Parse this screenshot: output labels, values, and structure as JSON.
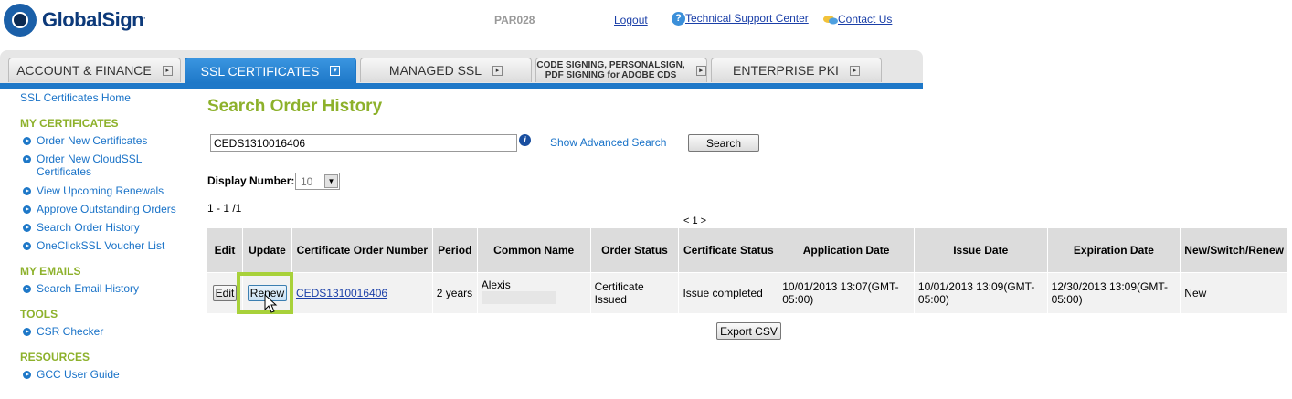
{
  "header": {
    "brand": "GlobalSign",
    "brand_mark": ".",
    "user_id": "PAR028",
    "logout": "Logout",
    "support": "Technical Support Center",
    "contact": "Contact Us"
  },
  "tabs": [
    {
      "label": "ACCOUNT & FINANCE",
      "active": false
    },
    {
      "label": "SSL CERTIFICATES",
      "active": true
    },
    {
      "label": "MANAGED SSL",
      "active": false
    },
    {
      "label_line1": "CODE SIGNING, PERSONALSIGN,",
      "label_line2": "PDF SIGNING for ADOBE CDS",
      "active": false
    },
    {
      "label": "ENTERPRISE PKI",
      "active": false
    }
  ],
  "sidebar": {
    "home": "SSL Certificates Home",
    "sections": [
      {
        "heading": "MY CERTIFICATES",
        "items": [
          "Order New Certificates",
          "Order New CloudSSL Certificates",
          "View Upcoming Renewals",
          "Approve Outstanding Orders",
          "Search Order History",
          "OneClickSSL Voucher List"
        ]
      },
      {
        "heading": "MY EMAILS",
        "items": [
          "Search Email History"
        ]
      },
      {
        "heading": "TOOLS",
        "items": [
          "CSR Checker"
        ]
      },
      {
        "heading": "RESOURCES",
        "items": [
          "GCC User Guide"
        ]
      }
    ]
  },
  "main": {
    "title": "Search Order History",
    "search_value": "CEDS1310016406",
    "advanced_search": "Show Advanced Search",
    "search_button": "Search",
    "display_number_label": "Display Number:",
    "display_number_value": "10",
    "result_count": "1 - 1 /1",
    "pagination": "< 1 >",
    "columns": [
      "Edit",
      "Update",
      "Certificate Order Number",
      "Period",
      "Common Name",
      "Order Status",
      "Certificate Status",
      "Application Date",
      "Issue Date",
      "Expiration Date",
      "New/Switch/Renew"
    ],
    "row": {
      "edit": "Edit",
      "update": "Renew",
      "order_number": "CEDS1310016406",
      "period": "2 years",
      "common_name": "Alexis",
      "order_status": "Certificate Issued",
      "certificate_status": "Issue completed",
      "application_date": "10/01/2013 13:07(GMT-05:00)",
      "issue_date": "10/01/2013 13:09(GMT-05:00)",
      "expiration_date": "12/30/2013 13:09(GMT-05:00)",
      "new_switch_renew": "New"
    },
    "export_button": "Export CSV"
  },
  "colors": {
    "brand_blue": "#1e78c8",
    "heading_green": "#8db12b",
    "highlight_green": "#a8d13a"
  }
}
